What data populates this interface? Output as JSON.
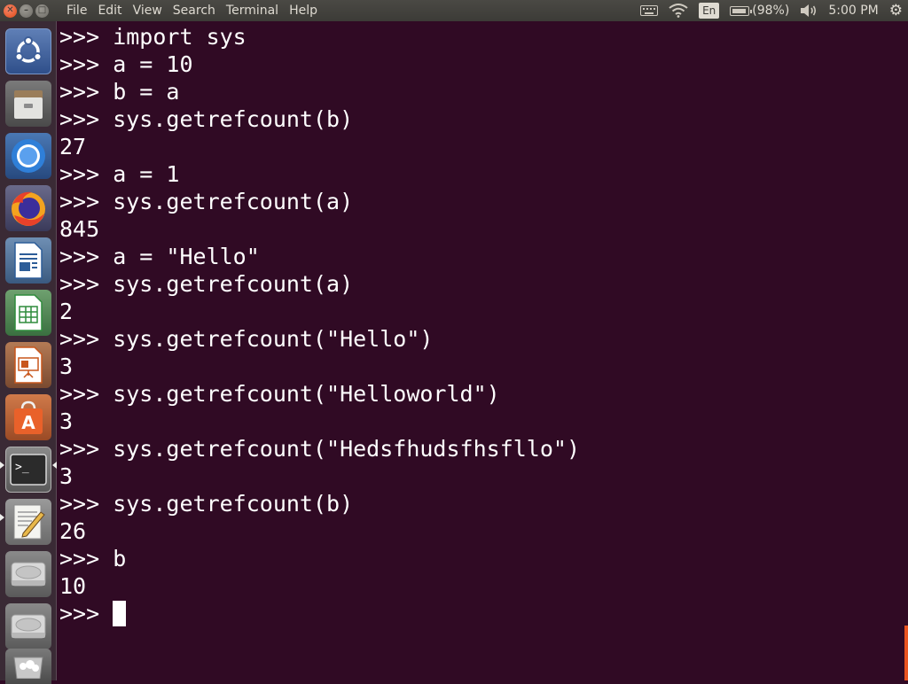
{
  "topbar": {
    "menus": [
      "File",
      "Edit",
      "View",
      "Search",
      "Terminal",
      "Help"
    ],
    "language": "En",
    "battery": "(98%)",
    "clock": "5:00 PM"
  },
  "launcher": {
    "items": [
      {
        "name": "ubuntu-dash",
        "icon": "ubuntu-logo-icon"
      },
      {
        "name": "files",
        "icon": "file-cabinet-icon"
      },
      {
        "name": "chromium",
        "icon": "chromium-icon"
      },
      {
        "name": "firefox",
        "icon": "firefox-icon"
      },
      {
        "name": "libreoffice-writer",
        "icon": "writer-icon"
      },
      {
        "name": "libreoffice-calc",
        "icon": "calc-icon"
      },
      {
        "name": "libreoffice-impress",
        "icon": "impress-icon"
      },
      {
        "name": "software-center",
        "icon": "shopping-bag-icon"
      },
      {
        "name": "terminal",
        "icon": "terminal-icon"
      },
      {
        "name": "text-editor",
        "icon": "text-editor-icon"
      },
      {
        "name": "drive-1",
        "icon": "hard-drive-icon"
      },
      {
        "name": "drive-2",
        "icon": "hard-drive-icon"
      },
      {
        "name": "trash",
        "icon": "trash-icon"
      }
    ],
    "terminal_prompt_glyph": ">_"
  },
  "terminal": {
    "lines": [
      ">>> import sys",
      ">>> a = 10",
      ">>> b = a",
      ">>> sys.getrefcount(b)",
      "27",
      ">>> a = 1",
      ">>> sys.getrefcount(a)",
      "845",
      ">>> a = \"Hello\"",
      ">>> sys.getrefcount(a)",
      "2",
      ">>> sys.getrefcount(\"Hello\")",
      "3",
      ">>> sys.getrefcount(\"Helloworld\")",
      "3",
      ">>> sys.getrefcount(\"Hedsfhudsfhsfllo\")",
      "3",
      ">>> sys.getrefcount(b)",
      "26",
      ">>> b",
      "10"
    ],
    "prompt": ">>> "
  },
  "colors": {
    "terminal_bg": "#300a24",
    "terminal_fg": "#ffffff",
    "accent": "#e95420"
  }
}
